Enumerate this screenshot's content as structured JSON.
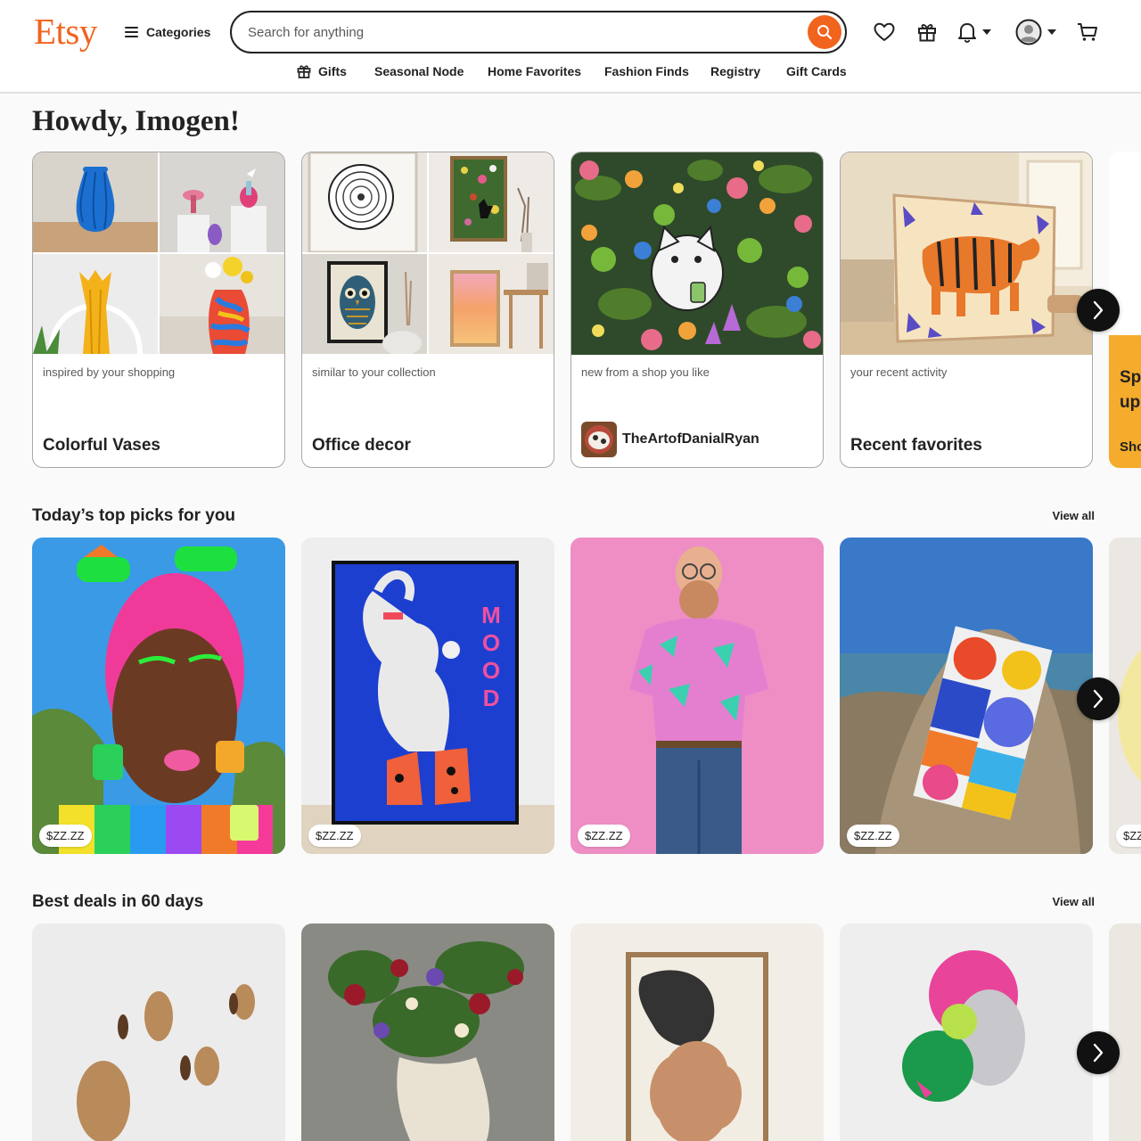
{
  "header": {
    "logo": "Etsy",
    "categories_label": "Categories",
    "search_placeholder": "Search for anything"
  },
  "subnav": [
    {
      "label": "Gifts"
    },
    {
      "label": "Seasonal Node"
    },
    {
      "label": "Home Favorites"
    },
    {
      "label": "Fashion Finds"
    },
    {
      "label": "Registry"
    },
    {
      "label": "Gift Cards"
    }
  ],
  "greeting": "Howdy, Imogen!",
  "top_cards": [
    {
      "subtitle": "inspired by your shopping",
      "title": "Colorful Vases"
    },
    {
      "subtitle": "similar to your collection",
      "title": "Office decor"
    },
    {
      "subtitle": "new from a shop you like",
      "shop_name": "TheArtofDanialRyan"
    },
    {
      "subtitle": "your recent activity",
      "title": "Recent favorites"
    }
  ],
  "promo_partial": {
    "line1": "Sp",
    "line2": "up",
    "cta": "Sho"
  },
  "top_picks": {
    "title": "Today’s top picks for you",
    "view_all": "View all",
    "items": [
      {
        "price": "$ZZ.ZZ"
      },
      {
        "price": "$ZZ.ZZ"
      },
      {
        "price": "$ZZ.ZZ"
      },
      {
        "price": "$ZZ.ZZ"
      },
      {
        "price": "$ZZ"
      }
    ]
  },
  "best_deals": {
    "title": "Best deals in 60 days",
    "view_all": "View all"
  },
  "poster_text": "MOOD",
  "colors": {
    "brand": "#f1641e",
    "text": "#222222",
    "border": "#a8a8a8"
  }
}
